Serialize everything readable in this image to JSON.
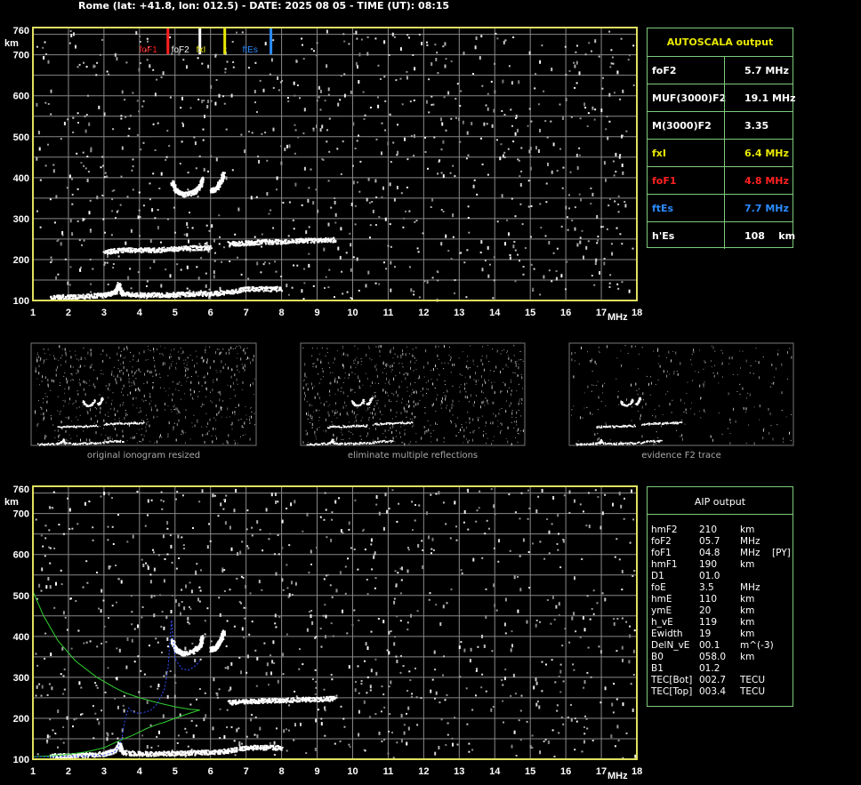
{
  "header": "Rome (lat: +41.8, lon: 012.5) - DATE: 2025 08 05 - TIME (UT): 08:15",
  "colors": {
    "frame": "#e0e060",
    "grid": "#888888",
    "panel": "#7ecb7e",
    "foF1": "#ff2020",
    "foF2": "#ffffff",
    "fxI": "#e8e800",
    "ftEs": "#2a8cff",
    "model": "#30d030",
    "trace": "#3050ff"
  },
  "chart_data": [
    {
      "type": "scatter",
      "title": "",
      "xlabel": "MHz",
      "ylabel": "km",
      "xlim": [
        1,
        18
      ],
      "ylim": [
        100,
        760
      ],
      "x_ticks": [
        1,
        2,
        3,
        4,
        5,
        6,
        7,
        8,
        9,
        10,
        11,
        12,
        13,
        14,
        15,
        16,
        17,
        18
      ],
      "y_ticks": [
        100,
        200,
        300,
        400,
        500,
        600,
        700,
        760
      ],
      "markers": [
        {
          "name": "foF1",
          "x": 4.8,
          "color": "#ff2020"
        },
        {
          "name": "foF2",
          "x": 5.7,
          "color": "#ffffff"
        },
        {
          "name": "fxI",
          "x": 6.4,
          "color": "#e8e800"
        },
        {
          "name": "ftEs",
          "x": 7.7,
          "color": "#2a8cff"
        }
      ],
      "echo_traces": [
        {
          "name": "Es layer",
          "x": [
            1.5,
            2.0,
            2.5,
            3.0,
            3.3,
            3.4,
            3.5,
            4.0,
            4.5,
            5.0,
            5.5,
            6.0,
            6.5,
            7.0,
            7.5,
            8.0
          ],
          "y": [
            110,
            110,
            112,
            115,
            122,
            140,
            118,
            115,
            115,
            116,
            118,
            118,
            122,
            130,
            130,
            130
          ]
        },
        {
          "name": "E trace",
          "x": [
            3.0,
            3.5,
            4.0,
            4.5,
            5.0,
            5.5,
            6.0
          ],
          "y": [
            220,
            225,
            225,
            225,
            228,
            230,
            230
          ]
        },
        {
          "name": "F layer",
          "x": [
            6.5,
            7.0,
            7.5,
            8.0,
            8.5,
            9.0,
            9.5
          ],
          "y": [
            240,
            242,
            245,
            245,
            248,
            248,
            250
          ]
        },
        {
          "name": "F2 trace",
          "x": [
            4.9,
            5.0,
            5.2,
            5.5,
            5.7,
            5.75
          ],
          "y": [
            390,
            370,
            360,
            365,
            380,
            400
          ]
        },
        {
          "name": "F2 trace x",
          "x": [
            6.0,
            6.1,
            6.2,
            6.3,
            6.35
          ],
          "y": [
            370,
            372,
            382,
            398,
            412
          ]
        }
      ]
    },
    {
      "type": "line",
      "title": "",
      "xlabel": "MHz",
      "ylabel": "km",
      "xlim": [
        1,
        18
      ],
      "ylim": [
        100,
        760
      ],
      "x_ticks": [
        1,
        2,
        3,
        4,
        5,
        6,
        7,
        8,
        9,
        10,
        11,
        12,
        13,
        14,
        15,
        16,
        17,
        18
      ],
      "y_ticks": [
        100,
        200,
        300,
        400,
        500,
        600,
        700,
        760
      ],
      "series": [
        {
          "color": "#30d030",
          "x": [
            1.0,
            1.3,
            1.7,
            2.2,
            2.8,
            3.3,
            3.6,
            4.0,
            4.5,
            5.0,
            5.4,
            5.7
          ],
          "y": [
            510,
            450,
            390,
            340,
            300,
            275,
            262,
            250,
            238,
            228,
            222,
            220
          ]
        },
        {
          "color": "#30d030",
          "x": [
            5.7,
            5.4,
            5.0,
            4.7,
            4.5,
            4.2,
            3.8,
            3.5,
            3.3,
            3.0,
            2.5,
            2.0,
            1.5,
            1.0
          ],
          "y": [
            220,
            212,
            200,
            190,
            185,
            175,
            158,
            148,
            140,
            128,
            118,
            112,
            108,
            106
          ]
        },
        {
          "color": "#3050ff",
          "x": [
            1.0,
            1.5,
            2.0,
            2.5,
            3.0,
            3.3,
            3.4,
            3.5,
            3.6,
            3.7,
            3.8,
            4.0,
            4.3,
            4.5,
            4.7,
            4.8,
            4.9,
            5.0,
            5.2,
            5.4,
            5.6,
            5.7
          ],
          "y": [
            106,
            106,
            107,
            108,
            110,
            118,
            130,
            150,
            200,
            225,
            215,
            212,
            218,
            235,
            270,
            320,
            440,
            345,
            320,
            318,
            330,
            340
          ]
        }
      ],
      "echo_traces": [
        {
          "name": "Es layer",
          "x": [
            1.5,
            2.0,
            2.5,
            3.0,
            3.3,
            3.4,
            3.5,
            4.0,
            4.5,
            5.0,
            5.5,
            6.0,
            6.5,
            7.0,
            7.5,
            8.0
          ],
          "y": [
            110,
            110,
            112,
            115,
            122,
            140,
            118,
            115,
            115,
            116,
            118,
            118,
            122,
            130,
            130,
            130
          ]
        },
        {
          "name": "F layer",
          "x": [
            6.5,
            7.0,
            7.5,
            8.0,
            8.5,
            9.0,
            9.5
          ],
          "y": [
            240,
            242,
            245,
            245,
            248,
            248,
            250
          ]
        },
        {
          "name": "F2 trace",
          "x": [
            4.9,
            5.0,
            5.2,
            5.5,
            5.7,
            5.75
          ],
          "y": [
            390,
            370,
            360,
            365,
            380,
            400
          ]
        },
        {
          "name": "F2 trace x",
          "x": [
            6.0,
            6.1,
            6.2,
            6.3,
            6.35
          ],
          "y": [
            370,
            372,
            382,
            398,
            412
          ]
        }
      ]
    }
  ],
  "autoscala": {
    "title": "AUTOSCALA output",
    "rows": [
      {
        "key": "foF2",
        "value": "5.7 MHz",
        "color": "#ffffff"
      },
      {
        "key": "MUF(3000)F2",
        "value": "19.1 MHz",
        "color": "#ffffff"
      },
      {
        "key": "M(3000)F2",
        "value": "3.35",
        "color": "#ffffff"
      },
      {
        "key": "fxI",
        "value": "6.4 MHz",
        "color": "#e8e800"
      },
      {
        "key": "foF1",
        "value": "4.8 MHz",
        "color": "#ff2020"
      },
      {
        "key": "ftEs",
        "value": "7.7 MHz",
        "color": "#2a8cff"
      },
      {
        "key": "h'Es",
        "value": "108    km",
        "color": "#ffffff"
      }
    ]
  },
  "aip": {
    "title": "AIP output",
    "rows": [
      {
        "k": "hmF2",
        "v": "210",
        "u": "km",
        "f": ""
      },
      {
        "k": "foF2",
        "v": "05.7",
        "u": "MHz",
        "f": ""
      },
      {
        "k": "foF1",
        "v": "04.8",
        "u": "MHz",
        "f": "[PY]"
      },
      {
        "k": "hmF1",
        "v": "190",
        "u": "km",
        "f": ""
      },
      {
        "k": "D1",
        "v": "01.0",
        "u": "",
        "f": ""
      },
      {
        "k": "foE",
        "v": "3.5",
        "u": "MHz",
        "f": ""
      },
      {
        "k": "hmE",
        "v": "110",
        "u": "km",
        "f": ""
      },
      {
        "k": "ymE",
        "v": "20",
        "u": "km",
        "f": ""
      },
      {
        "k": "h_vE",
        "v": "119",
        "u": "km",
        "f": ""
      },
      {
        "k": "Ewidth",
        "v": "19",
        "u": "km",
        "f": ""
      },
      {
        "k": "DelN_vE",
        "v": "00.1",
        "u": "m^(-3)",
        "f": ""
      },
      {
        "k": "B0",
        "v": "058.0",
        "u": "km",
        "f": ""
      },
      {
        "k": "B1",
        "v": "01.2",
        "u": "",
        "f": ""
      },
      {
        "k": "TEC[Bot]",
        "v": "002.7",
        "u": "TECU",
        "f": ""
      },
      {
        "k": "TEC[Top]",
        "v": "003.4",
        "u": "TECU",
        "f": ""
      }
    ]
  },
  "thumbnails": [
    {
      "caption": "original ionogram resized",
      "mode": "full"
    },
    {
      "caption": "eliminate multiple reflections",
      "mode": "full"
    },
    {
      "caption": "evidence F2 trace",
      "mode": "sparse"
    }
  ]
}
